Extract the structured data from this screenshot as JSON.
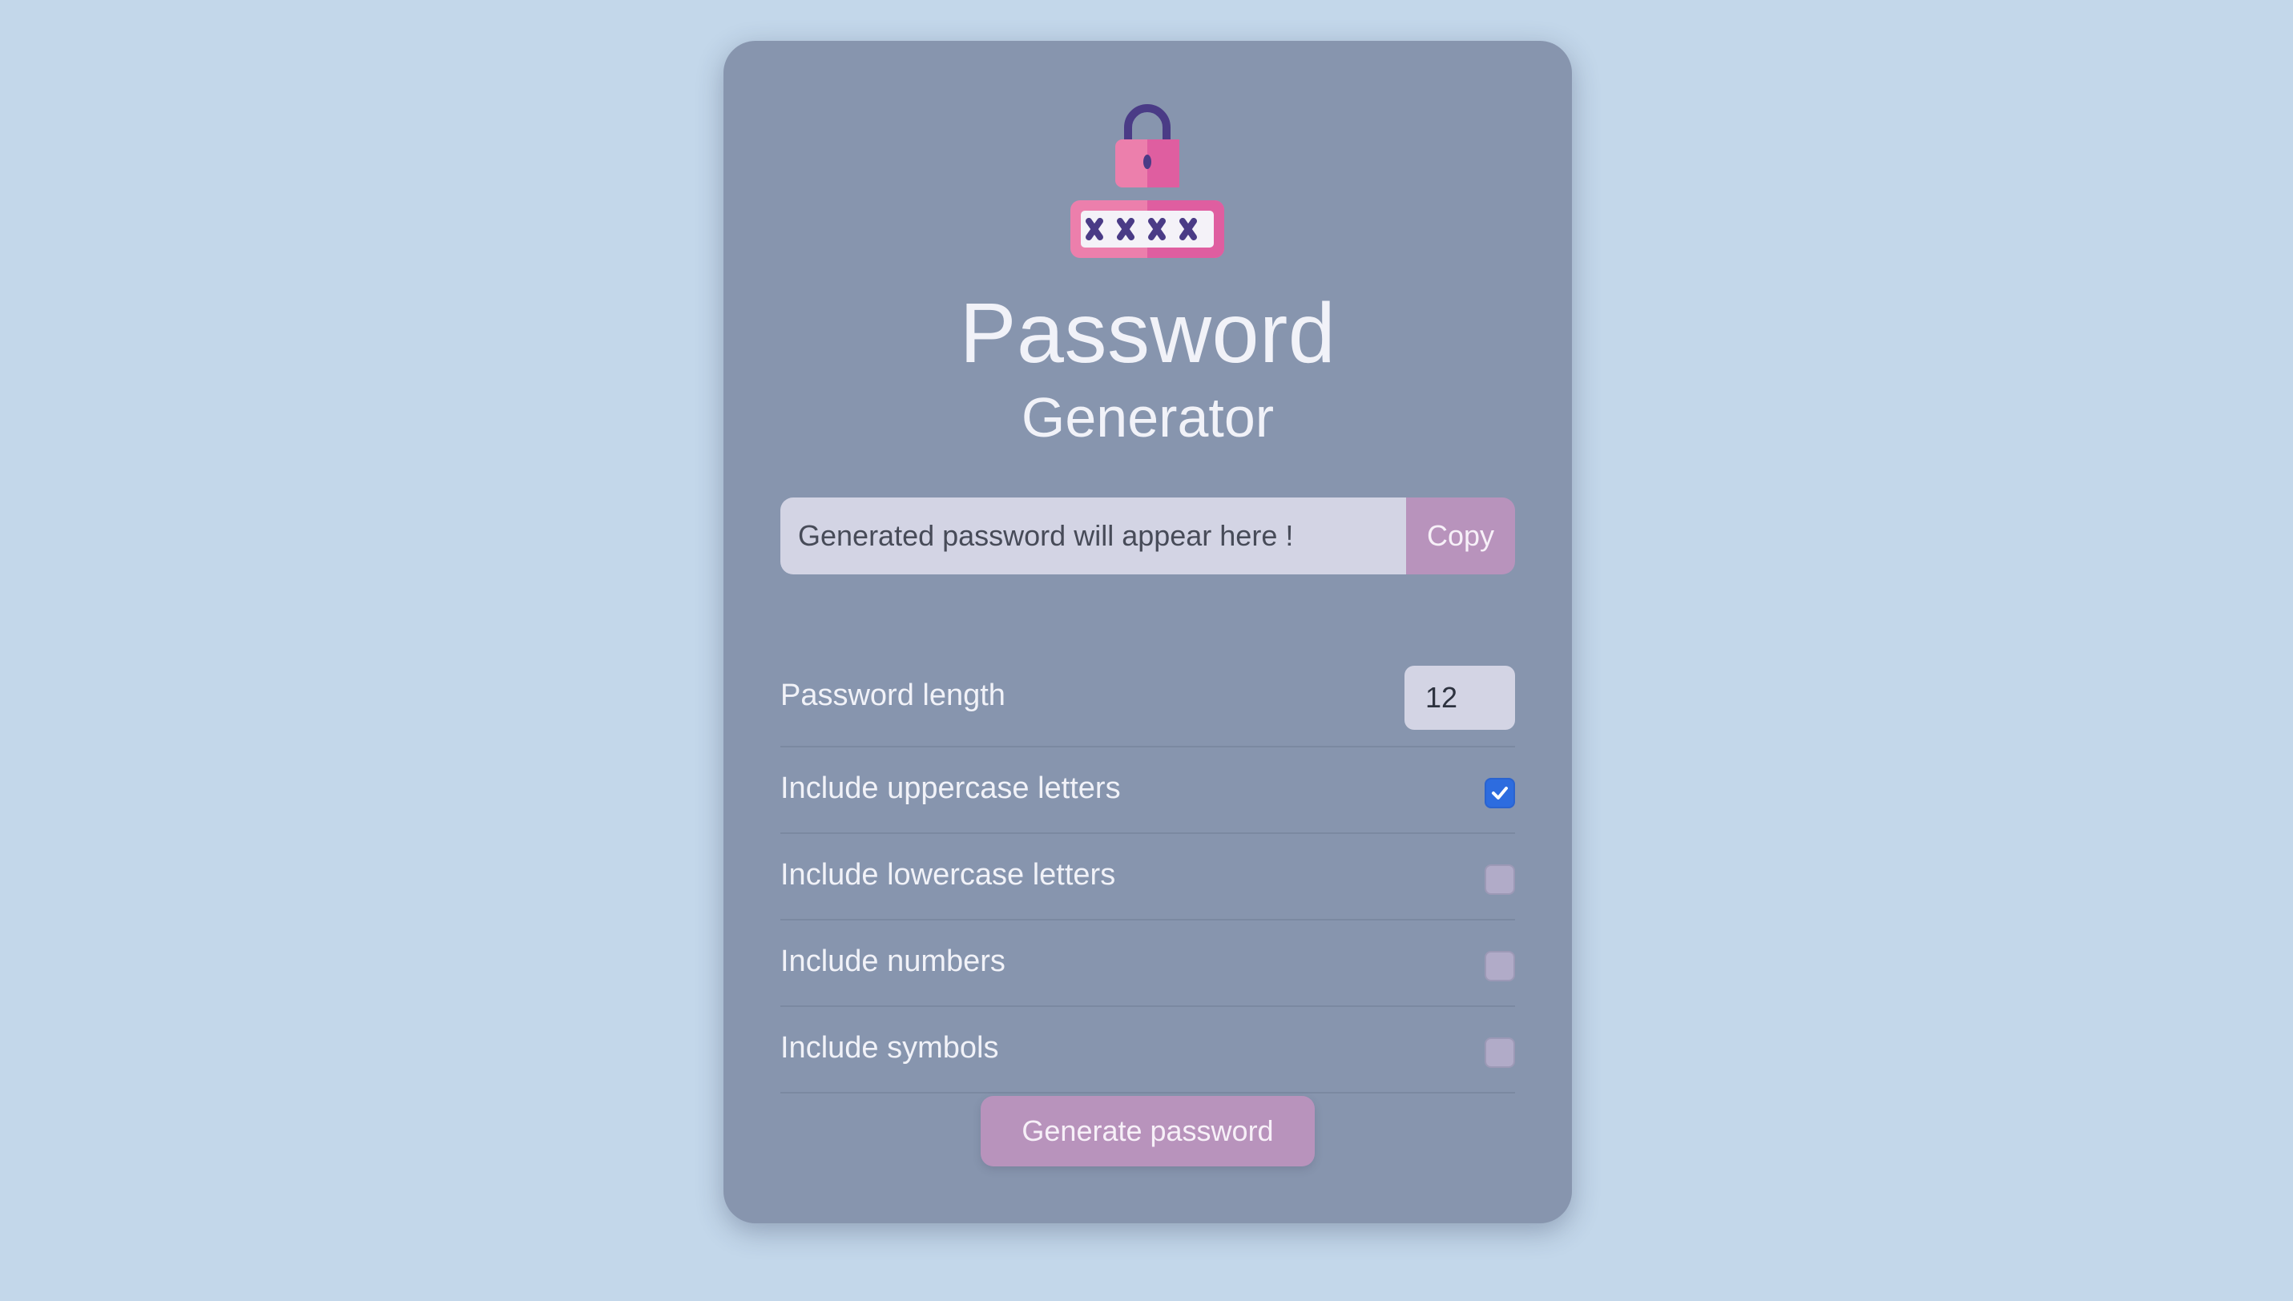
{
  "app": {
    "title": "Password",
    "subtitle": "Generator",
    "logo_icon": "padlock-password-icon"
  },
  "output": {
    "placeholder": "Generated password will appear here !",
    "value": "",
    "copy_label": "Copy"
  },
  "length": {
    "label": "Password length",
    "value": "12"
  },
  "options": [
    {
      "label": "Include uppercase letters",
      "checked": true
    },
    {
      "label": "Include lowercase letters",
      "checked": false
    },
    {
      "label": "Include numbers",
      "checked": false
    },
    {
      "label": "Include symbols",
      "checked": false
    }
  ],
  "generate_label": "Generate password",
  "colors": {
    "background": "#c3d7ea",
    "card": "#8795ae",
    "accent": "#b893bc",
    "checkbox_checked": "#2d6cdf",
    "lock_pink": "#ec7fac",
    "lock_navy": "#4a3b86"
  }
}
